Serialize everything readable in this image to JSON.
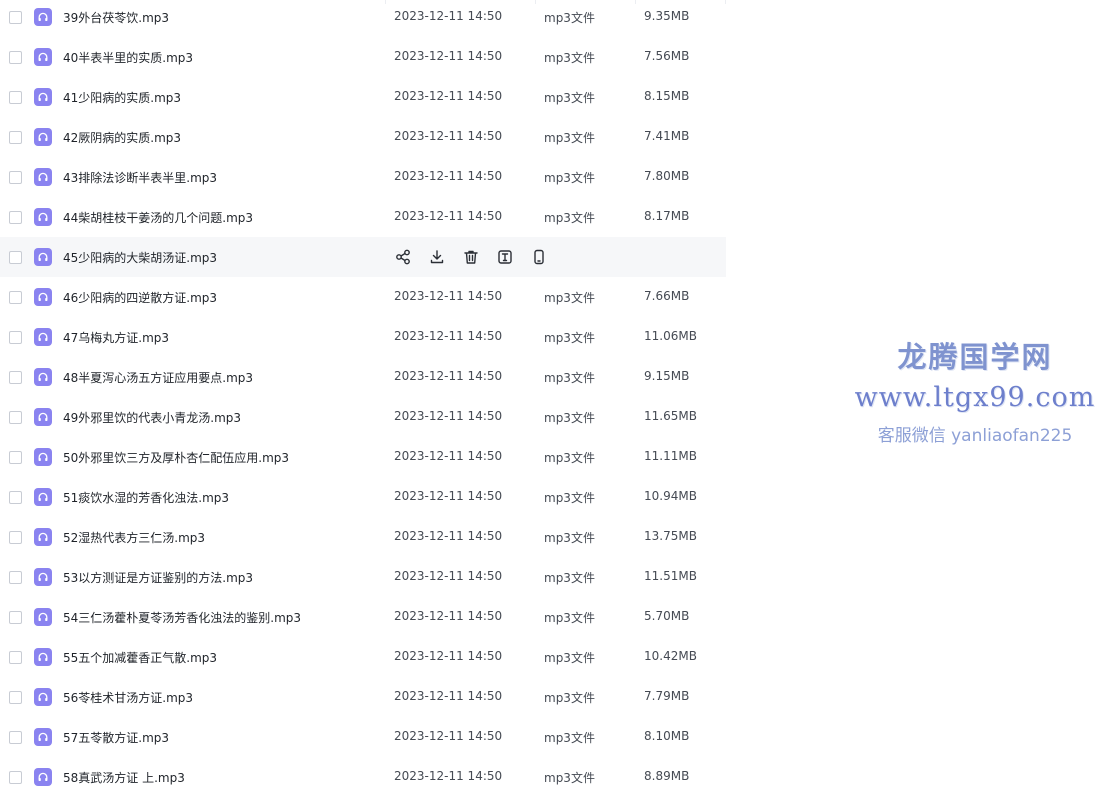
{
  "files": [
    {
      "name": "39外台茯苓饮.mp3",
      "date": "2023-12-11 14:50",
      "type": "mp3文件",
      "size": "9.35MB"
    },
    {
      "name": "40半表半里的实质.mp3",
      "date": "2023-12-11 14:50",
      "type": "mp3文件",
      "size": "7.56MB"
    },
    {
      "name": "41少阳病的实质.mp3",
      "date": "2023-12-11 14:50",
      "type": "mp3文件",
      "size": "8.15MB"
    },
    {
      "name": "42厥阴病的实质.mp3",
      "date": "2023-12-11 14:50",
      "type": "mp3文件",
      "size": "7.41MB"
    },
    {
      "name": "43排除法诊断半表半里.mp3",
      "date": "2023-12-11 14:50",
      "type": "mp3文件",
      "size": "7.80MB"
    },
    {
      "name": "44柴胡桂枝干姜汤的几个问题.mp3",
      "date": "2023-12-11 14:50",
      "type": "mp3文件",
      "size": "8.17MB"
    },
    {
      "name": "45少阳病的大柴胡汤证.mp3",
      "date": "",
      "type": "",
      "size": "",
      "hovered": true
    },
    {
      "name": "46少阳病的四逆散方证.mp3",
      "date": "2023-12-11 14:50",
      "type": "mp3文件",
      "size": "7.66MB"
    },
    {
      "name": "47乌梅丸方证.mp3",
      "date": "2023-12-11 14:50",
      "type": "mp3文件",
      "size": "11.06MB"
    },
    {
      "name": "48半夏泻心汤五方证应用要点.mp3",
      "date": "2023-12-11 14:50",
      "type": "mp3文件",
      "size": "9.15MB"
    },
    {
      "name": "49外邪里饮的代表小青龙汤.mp3",
      "date": "2023-12-11 14:50",
      "type": "mp3文件",
      "size": "11.65MB"
    },
    {
      "name": "50外邪里饮三方及厚朴杏仁配伍应用.mp3",
      "date": "2023-12-11 14:50",
      "type": "mp3文件",
      "size": "11.11MB"
    },
    {
      "name": "51痰饮水湿的芳香化浊法.mp3",
      "date": "2023-12-11 14:50",
      "type": "mp3文件",
      "size": "10.94MB"
    },
    {
      "name": "52湿热代表方三仁汤.mp3",
      "date": "2023-12-11 14:50",
      "type": "mp3文件",
      "size": "13.75MB"
    },
    {
      "name": "53以方测证是方证鉴别的方法.mp3",
      "date": "2023-12-11 14:50",
      "type": "mp3文件",
      "size": "11.51MB"
    },
    {
      "name": "54三仁汤藿朴夏苓汤芳香化浊法的鉴别.mp3",
      "date": "2023-12-11 14:50",
      "type": "mp3文件",
      "size": "5.70MB"
    },
    {
      "name": "55五个加减藿香正气散.mp3",
      "date": "2023-12-11 14:50",
      "type": "mp3文件",
      "size": "10.42MB"
    },
    {
      "name": "56苓桂术甘汤方证.mp3",
      "date": "2023-12-11 14:50",
      "type": "mp3文件",
      "size": "7.79MB"
    },
    {
      "name": "57五苓散方证.mp3",
      "date": "2023-12-11 14:50",
      "type": "mp3文件",
      "size": "8.10MB"
    },
    {
      "name": "58真武汤方证 上.mp3",
      "date": "2023-12-11 14:50",
      "type": "mp3文件",
      "size": "8.89MB"
    }
  ],
  "hover_actions": [
    "share-icon",
    "download-icon",
    "delete-icon",
    "rename-icon",
    "mobile-icon"
  ],
  "watermark": {
    "title": "龙腾国学网",
    "url": "www.ltgx99.com",
    "contact": "客服微信 yanliaofan225"
  },
  "colors": {
    "audio_icon": "#8a83f0",
    "hover_row": "#f6f7f9",
    "watermark": "#7f93cf"
  }
}
